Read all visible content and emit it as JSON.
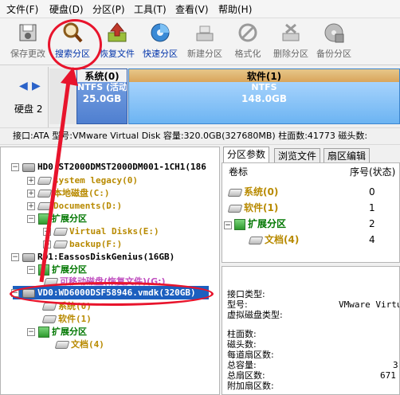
{
  "menu": {
    "file": "文件(F)",
    "disk": "硬盘(D)",
    "partition": "分区(P)",
    "tools": "工具(T)",
    "view": "查看(V)",
    "help": "帮助(H)"
  },
  "toolbar": {
    "save": "保存更改",
    "search": "搜索分区",
    "recover": "恢复文件",
    "quick": "快速分区",
    "new": "新建分区",
    "format": "格式化",
    "delete": "删除分区",
    "backup": "备份分区"
  },
  "diskbar": {
    "disk_label": "硬盘 2",
    "system": {
      "name": "系统(0)",
      "fs": "NTFS (活动",
      "size": "25.0GB"
    },
    "software": {
      "name": "软件(1)",
      "fs": "NTFS",
      "size": "148.0GB"
    }
  },
  "infoline": "接口:ATA  型号:VMware Virtual Disk  容量:320.0GB(327680MB)  柱面数:41773  磁头数:",
  "tree": {
    "hd0": "HD0:ST2000DMST2000DM001-1CH1(186",
    "hd0_items": [
      "system legacy(0)",
      "本地磁盘(C:)",
      "Documents(D:)",
      "扩展分区",
      "Virtual Disks(E:)",
      "backup(F:)"
    ],
    "rd1": "RD1:EassosDiskGenius(16GB)",
    "rd1_items": [
      "扩展分区",
      "可移动磁盘(恢复文件)(G:)"
    ],
    "vd0": "VD0:WD6000DSF58946.vmdk(320GB)",
    "vd0_items": [
      "系统(0)",
      "软件(1)",
      "扩展分区",
      "文档(4)"
    ]
  },
  "tabs": [
    "分区参数",
    "浏览文件",
    "扇区编辑"
  ],
  "plist": {
    "col_label": "卷标",
    "col_seq": "序号(状态)",
    "rows": [
      {
        "label": "系统(0)",
        "seq": "0"
      },
      {
        "label": "软件(1)",
        "seq": "1"
      },
      {
        "label": "扩展分区",
        "seq": "2"
      },
      {
        "label": "文档(4)",
        "seq": "4"
      }
    ]
  },
  "details": {
    "labels": [
      "接口类型:",
      "型号:",
      "虚拟磁盘类型:",
      "柱面数:",
      "磁头数:",
      "每道扇区数:",
      "总容量:",
      "总扇区数:",
      "附加扇区数:"
    ],
    "model_value": "VMware Virtus",
    "capacity_value": "3",
    "sectors_value": "671"
  },
  "colors": {
    "annotation": "#e8142c",
    "selection": "#1c5fbf"
  }
}
